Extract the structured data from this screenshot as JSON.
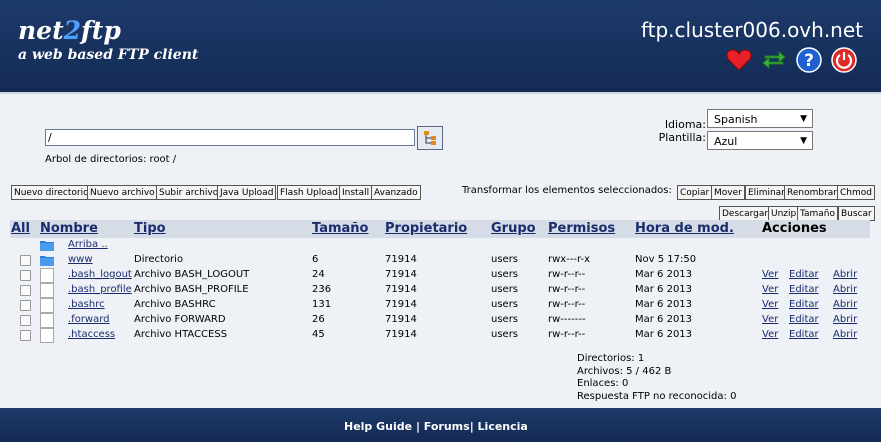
{
  "header": {
    "logo_main": "net2ftp",
    "logo_main_a": "net",
    "logo_main_b": "2",
    "logo_main_c": "ftp",
    "logo_sub": "a web based FTP client",
    "host": "ftp.cluster006.ovh.net",
    "icons": [
      "heart-icon",
      "refresh-icon",
      "help-icon",
      "power-icon"
    ]
  },
  "pathbar": {
    "path_value": "/",
    "tree_label": "Arbol de directorios:",
    "tree_path": "root /"
  },
  "settings": {
    "idioma_label": "Idioma:",
    "idioma_value": "Spanish",
    "plantilla_label": "Plantilla:",
    "plantilla_value": "Azul"
  },
  "toolbar": {
    "new_dir": "Nuevo directorio",
    "new_file": "Nuevo archivo",
    "upload": "Subir archivo",
    "java_upload": "Java Upload",
    "flash_upload": "Flash Upload",
    "install": "Install",
    "advanced": "Avanzado",
    "transform_label": "Transformar los elementos seleccionados:",
    "copy": "Copiar",
    "move": "Mover",
    "delete": "Eliminar",
    "rename": "Renombrar",
    "chmod": "Chmod",
    "download": "Descargar",
    "unzip": "Unzip",
    "size": "Tamaño",
    "search": "Buscar"
  },
  "table": {
    "headers": {
      "all": "All",
      "name": "Nombre",
      "type": "Tipo",
      "size": "Tamaño",
      "owner": "Propietario",
      "group": "Grupo",
      "perms": "Permisos",
      "mtime": "Hora de mod.",
      "actions": "Acciones"
    },
    "up_label": "Arriba ..",
    "rows": [
      {
        "name": "www",
        "type": "Directorio",
        "size": "6",
        "owner": "71914",
        "group": "users",
        "perms": "rwx---r-x",
        "mtime": "Nov 5 17:50",
        "is_dir": true
      },
      {
        "name": ".bash_logout",
        "type": "Archivo BASH_LOGOUT",
        "size": "24",
        "owner": "71914",
        "group": "users",
        "perms": "rw-r--r--",
        "mtime": "Mar 6 2013",
        "is_dir": false
      },
      {
        "name": ".bash_profile",
        "type": "Archivo BASH_PROFILE",
        "size": "236",
        "owner": "71914",
        "group": "users",
        "perms": "rw-r--r--",
        "mtime": "Mar 6 2013",
        "is_dir": false
      },
      {
        "name": ".bashrc",
        "type": "Archivo BASHRC",
        "size": "131",
        "owner": "71914",
        "group": "users",
        "perms": "rw-r--r--",
        "mtime": "Mar 6 2013",
        "is_dir": false
      },
      {
        "name": ".forward",
        "type": "Archivo FORWARD",
        "size": "26",
        "owner": "71914",
        "group": "users",
        "perms": "rw-------",
        "mtime": "Mar 6 2013",
        "is_dir": false
      },
      {
        "name": ".htaccess",
        "type": "Archivo HTACCESS",
        "size": "45",
        "owner": "71914",
        "group": "users",
        "perms": "rw-r--r--",
        "mtime": "Mar 6 2013",
        "is_dir": false
      }
    ],
    "action_view": "Ver",
    "action_edit": "Editar",
    "action_open": "Abrir"
  },
  "stats": {
    "dirs": "Directorios: 1",
    "files": "Archivos: 5 / 462 B",
    "links": "Enlaces: 0",
    "unrecognized": "Respuesta FTP no reconocida: 0"
  },
  "footer": {
    "help": "Help Guide",
    "sep1": " | ",
    "forums": "Forums",
    "sep2": "| ",
    "license": "Licencia"
  },
  "colors": {
    "header_bg": "#17315e",
    "link": "#1a2c6e",
    "band": "#d5dce6",
    "main_bg": "#eef1f5"
  }
}
